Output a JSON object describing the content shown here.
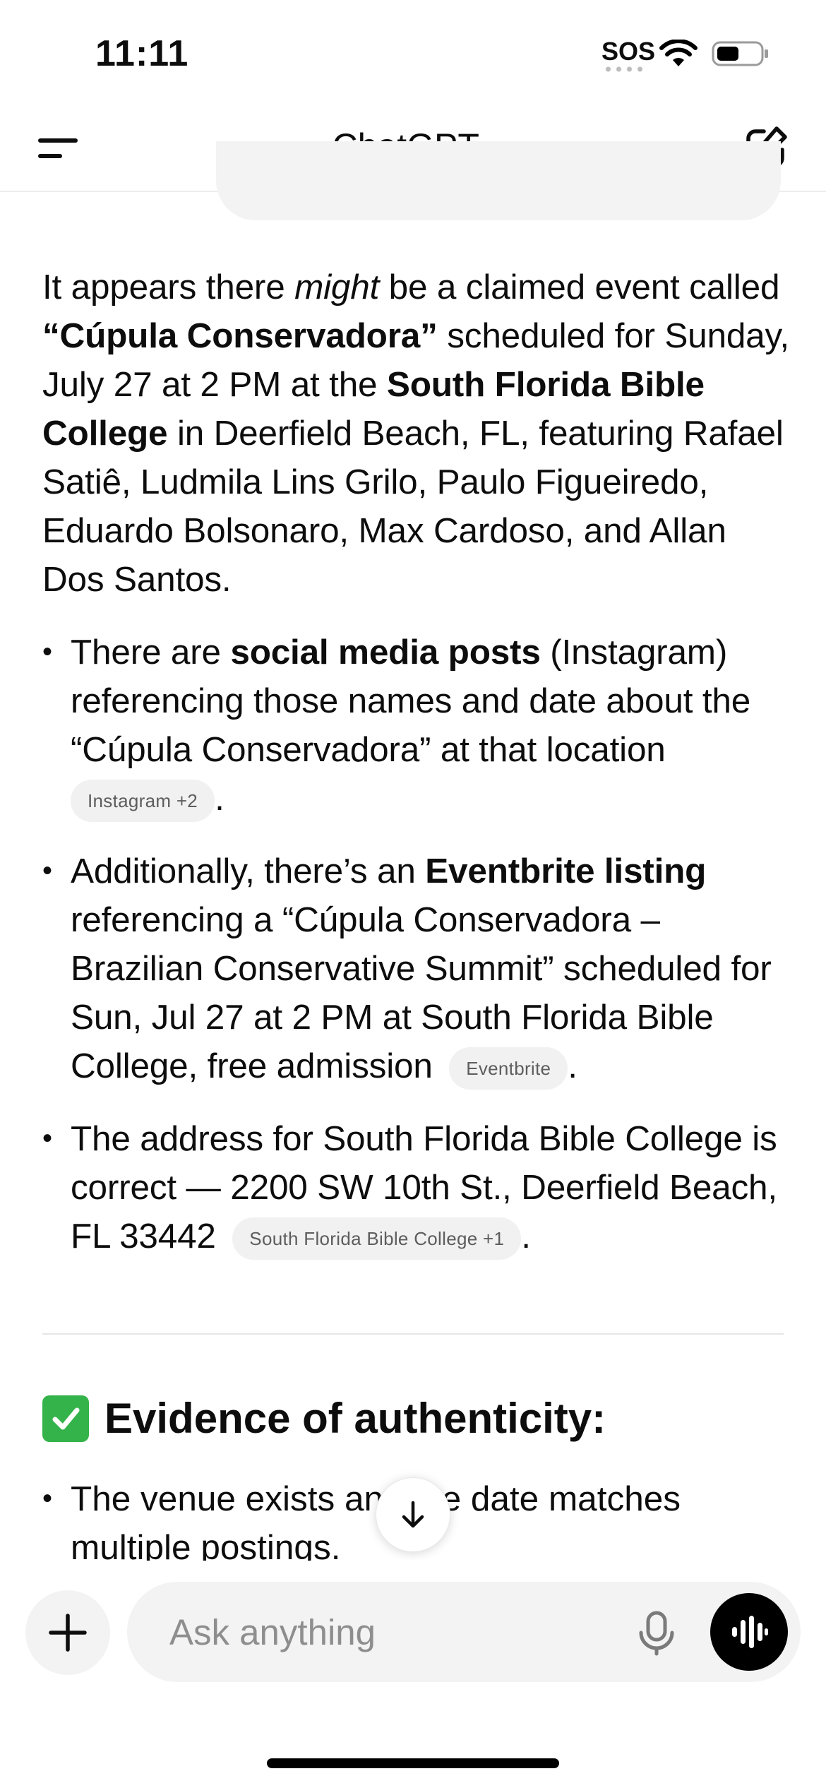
{
  "status_bar": {
    "time": "11:11",
    "sos": "SOS"
  },
  "header": {
    "title": "ChatGPT",
    "chevron": "›"
  },
  "message": {
    "intro": {
      "t1": "It appears there ",
      "em1": "might",
      "t2": " be a claimed event called ",
      "b1": "“Cúpula Conservadora”",
      "t3": " scheduled for Sunday, July 27 at 2 PM at the ",
      "b2": "South Florida Bible College",
      "t4": " in Deerfield Beach, FL, featuring Rafael Satiê, Ludmila Lins Grilo, Paulo Figueiredo, Eduardo Bolsonaro, Max Cardoso, and Allan Dos Santos."
    },
    "bullets": [
      {
        "t1": "There are ",
        "b1": "social media posts",
        "t2": " (Instagram) referencing those names and date about the “Cúpula Conservadora” at that location",
        "pill": "Instagram +2",
        "end": "."
      },
      {
        "t1": "Additionally, there’s an ",
        "b1": "Eventbrite listing",
        "t2": " referencing a “Cúpula Conservadora – Brazilian Conservative Summit” scheduled for Sun, Jul 27 at 2 PM at South Florida Bible College, free admission ",
        "pill": "Eventbrite",
        "end": "."
      },
      {
        "t1": "The address for South Florida Bible College is correct — 2200 SW 10th St., Deerfield Beach, FL 33442 ",
        "pill": "South Florida Bible College +1",
        "end": "."
      }
    ],
    "evidence_heading": "Evidence of authenticity:",
    "evidence_items": [
      "The venue exists and the date matches multiple postings."
    ]
  },
  "composer": {
    "placeholder": "Ask anything"
  },
  "icons": {
    "menu": "menu-icon",
    "edit": "new-chat-edit-icon",
    "check": "check-mark-button-icon",
    "scroll": "arrow-down-icon",
    "plus": "plus-icon",
    "mic": "microphone-icon",
    "voice": "voice-waveform-icon"
  },
  "colors": {
    "check_green": "#34b34a",
    "pill_bg": "#f1f1f1",
    "composer_bg": "#f3f3f3"
  }
}
